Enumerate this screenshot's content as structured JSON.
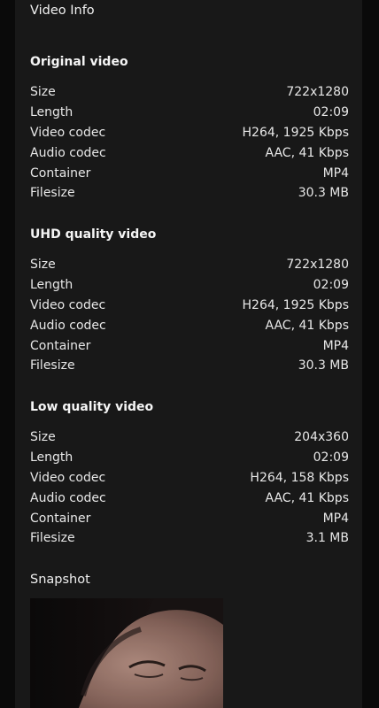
{
  "panel": {
    "title": "Video Info"
  },
  "sections": [
    {
      "title": "Original video",
      "rows": [
        {
          "label": "Size",
          "value": "722x1280"
        },
        {
          "label": "Length",
          "value": "02:09"
        },
        {
          "label": "Video codec",
          "value": "H264, 1925 Kbps"
        },
        {
          "label": "Audio codec",
          "value": "AAC, 41 Kbps"
        },
        {
          "label": "Container",
          "value": "MP4"
        },
        {
          "label": "Filesize",
          "value": "30.3 MB"
        }
      ]
    },
    {
      "title": "UHD quality video",
      "rows": [
        {
          "label": "Size",
          "value": "722x1280"
        },
        {
          "label": "Length",
          "value": "02:09"
        },
        {
          "label": "Video codec",
          "value": "H264, 1925 Kbps"
        },
        {
          "label": "Audio codec",
          "value": "AAC, 41 Kbps"
        },
        {
          "label": "Container",
          "value": "MP4"
        },
        {
          "label": "Filesize",
          "value": "30.3 MB"
        }
      ]
    },
    {
      "title": "Low quality video",
      "rows": [
        {
          "label": "Size",
          "value": "204x360"
        },
        {
          "label": "Length",
          "value": "02:09"
        },
        {
          "label": "Video codec",
          "value": "H264, 158 Kbps"
        },
        {
          "label": "Audio codec",
          "value": "AAC, 41 Kbps"
        },
        {
          "label": "Container",
          "value": "MP4"
        },
        {
          "label": "Filesize",
          "value": "3.1 MB"
        }
      ]
    }
  ],
  "snapshot": {
    "label": "Snapshot"
  }
}
